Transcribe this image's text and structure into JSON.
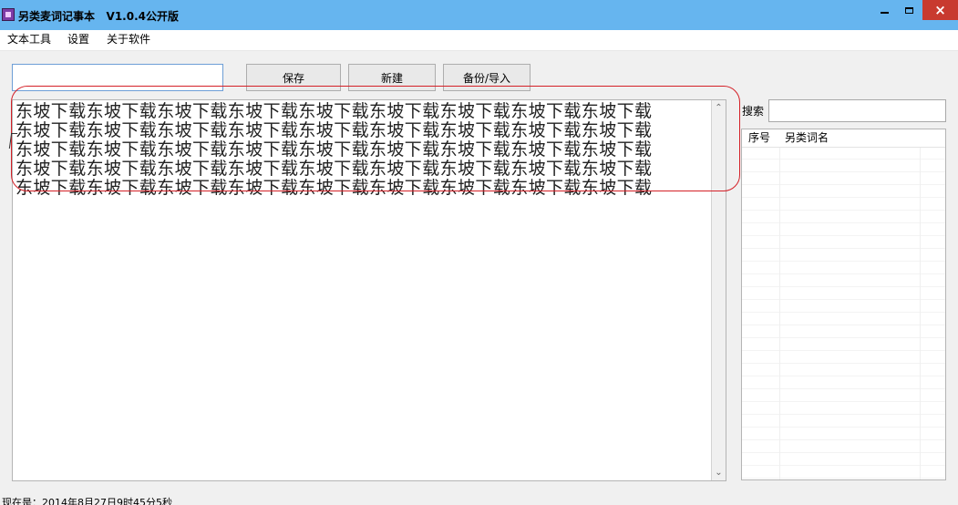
{
  "window": {
    "title": "另类麦词记事本   V1.0.4公开版",
    "minimize_icon": "minimize-icon",
    "maximize_icon": "maximize-icon",
    "close_label": "×"
  },
  "menu": {
    "items": [
      {
        "label": "文本工具"
      },
      {
        "label": "设置"
      },
      {
        "label": "关于软件"
      }
    ]
  },
  "toolbar": {
    "input_value": "",
    "save_label": "保存",
    "new_label": "新建",
    "backup_label": "备份/导入"
  },
  "editor": {
    "content": "东坡下载东坡下载东坡下载东坡下载东坡下载东坡下载东坡下载东坡下载东坡下载\n东坡下载东坡下载东坡下载东坡下载东坡下载东坡下载东坡下载东坡下载东坡下载\n东坡下载东坡下载东坡下载东坡下载东坡下载东坡下载东坡下载东坡下载东坡下载\n东坡下载东坡下载东坡下载东坡下载东坡下载东坡下载东坡下载东坡下载东坡下载\n东坡下载东坡下载东坡下载东坡下载东坡下载东坡下载东坡下载东坡下载东坡下载"
  },
  "sidebar": {
    "search_label": "搜索",
    "search_value": "",
    "list_headers": {
      "index": "序号",
      "name": "另类词名"
    }
  },
  "status": {
    "text": "现在是：2014年8月27日9时45分5秒"
  },
  "colors": {
    "titlebar": "#66b5ef",
    "close_button": "#c83a2f",
    "annotation": "#d42027"
  }
}
